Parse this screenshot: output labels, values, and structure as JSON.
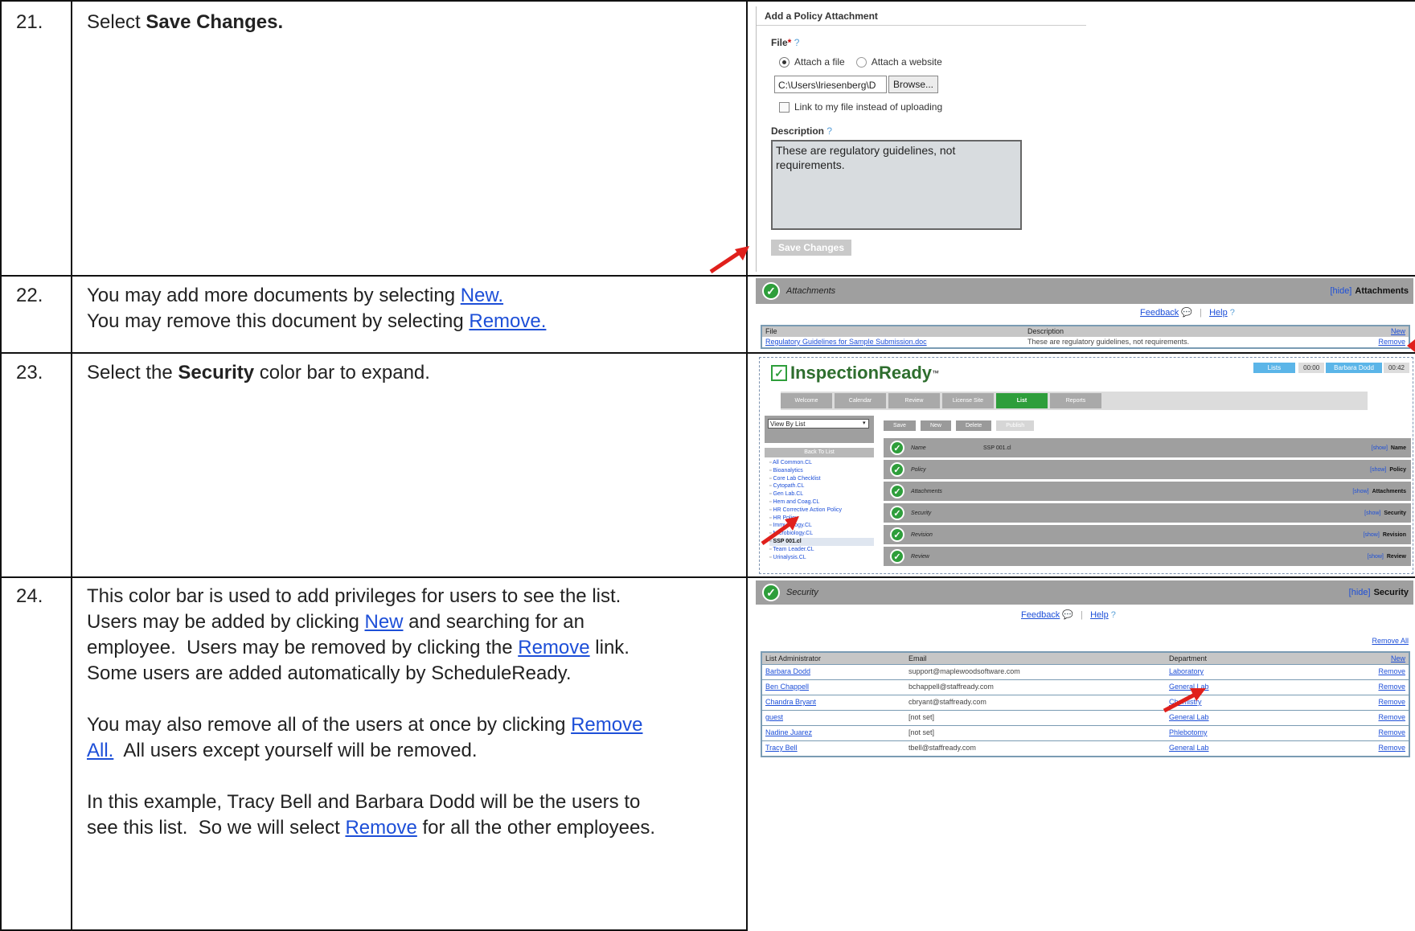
{
  "rows": [
    {
      "num": "21.",
      "lines": [
        [
          {
            "t": "Select "
          },
          {
            "t": "Save Changes.",
            "b": true
          }
        ]
      ]
    },
    {
      "num": "22.",
      "lines": [
        [
          {
            "t": "You may add more documents by selecting "
          },
          {
            "t": "New.",
            "l": true
          }
        ],
        [
          {
            "t": "You may remove this document by selecting "
          },
          {
            "t": "Remove.",
            "l": true
          }
        ]
      ]
    },
    {
      "num": "23.",
      "lines": [
        [
          {
            "t": "Select the "
          },
          {
            "t": "Security",
            "b": true
          },
          {
            "t": " color bar to expand."
          }
        ]
      ]
    },
    {
      "num": "24.",
      "lines": [
        [
          {
            "t": "This color bar is used to add privileges for users to see the list."
          }
        ],
        [
          {
            "t": "Users may be added by clicking "
          },
          {
            "t": "New",
            "l": true
          },
          {
            "t": " and searching for an"
          }
        ],
        [
          {
            "t": "employee.  Users may be removed by clicking the "
          },
          {
            "t": "Remove",
            "l": true
          },
          {
            "t": " link."
          }
        ],
        [
          {
            "t": "Some users are added automatically by ScheduleReady."
          }
        ],
        [
          {
            "t": ""
          }
        ],
        [
          {
            "t": "You may also remove all of the users at once by clicking "
          },
          {
            "t": "Remove",
            "l": true
          }
        ],
        [
          {
            "t": "All.",
            "l": true
          },
          {
            "t": "  All users except yourself will be removed."
          }
        ],
        [
          {
            "t": ""
          }
        ],
        [
          {
            "t": "In this example, Tracy Bell and Barbara Dodd will be the users to"
          }
        ],
        [
          {
            "t": "see this list.  So we will select "
          },
          {
            "t": "Remove",
            "l": true
          },
          {
            "t": " for all the other employees."
          }
        ]
      ]
    }
  ],
  "shot1": {
    "title": "Add a Policy Attachment",
    "file_label": "File",
    "req": "*",
    "help": "?",
    "radio_file": "Attach a file",
    "radio_web": "Attach a website",
    "path_value": "C:\\Users\\lriesenberg\\D",
    "browse": "Browse...",
    "link_checkbox": "Link to my file instead of uploading",
    "desc_label": "Description",
    "desc_value": "These are regulatory guidelines, not requirements.",
    "save": "Save Changes"
  },
  "shot2": {
    "bar_label": "Attachments",
    "hide": "[hide]",
    "bar_right": "Attachments",
    "feedback": "Feedback",
    "help": "Help",
    "col_file": "File",
    "col_desc": "Description",
    "col_new": "New",
    "file_link": "Regulatory Guidelines for Sample Submission.doc",
    "desc": "These are regulatory guidelines, not requirements.",
    "remove": "Remove"
  },
  "shot3": {
    "logo": "InspectionReady",
    "tm": "™",
    "top_right": [
      "Lists",
      "00:00",
      "Barbara Dodd",
      "00:42"
    ],
    "tabs": [
      "Welcome",
      "Calendar",
      "Review",
      "License Site",
      "List",
      "Reports"
    ],
    "active_tab": "List",
    "view_select": "View By List",
    "buttons": [
      "Save",
      "New",
      "Delete",
      "Publish"
    ],
    "back": "Back To List",
    "tree": [
      "All Common.CL",
      "Bioanalytics",
      "Core Lab Checklist",
      "Cytopath.CL",
      "Gen Lab.CL",
      "Hem and Coag.CL",
      "HR Corrective Action Policy",
      "HR Policy",
      "Immunology.CL",
      "Microbiology.CL",
      "SSP 001.cl",
      "Team Leader.CL",
      "Urinalysis.CL"
    ],
    "selected_tree": "SSP 001.cl",
    "bars": [
      {
        "label": "Name",
        "value": "SSP 001.cl",
        "right": "Name"
      },
      {
        "label": "Policy",
        "value": "",
        "right": "Policy"
      },
      {
        "label": "Attachments",
        "value": "",
        "right": "Attachments"
      },
      {
        "label": "Security",
        "value": "",
        "right": "Security"
      },
      {
        "label": "Revision",
        "value": "",
        "right": "Revision"
      },
      {
        "label": "Review",
        "value": "",
        "right": "Review"
      }
    ],
    "show": "[show]"
  },
  "shot4": {
    "bar_label": "Security",
    "hide": "[hide]",
    "bar_right": "Security",
    "feedback": "Feedback",
    "help": "Help",
    "remove_all": "Remove All",
    "headers": [
      "List Administrator",
      "Email",
      "Department",
      "New"
    ],
    "rows": [
      {
        "name": "Barbara Dodd",
        "email": "support@maplewoodsoftware.com",
        "dept": "Laboratory",
        "action": "Remove"
      },
      {
        "name": "Ben Chappell",
        "email": "bchappell@staffready.com",
        "dept": "General Lab",
        "action": "Remove"
      },
      {
        "name": "Chandra Bryant",
        "email": "cbryant@staffready.com",
        "dept": "Chemistry",
        "action": "Remove"
      },
      {
        "name": "guest",
        "email": "[not set]",
        "dept": "General Lab",
        "action": "Remove"
      },
      {
        "name": "Nadine Juarez",
        "email": "[not set]",
        "dept": "Phlebotomy",
        "action": "Remove"
      },
      {
        "name": "Tracy Bell",
        "email": "tbell@staffready.com",
        "dept": "General Lab",
        "action": "Remove"
      }
    ]
  }
}
